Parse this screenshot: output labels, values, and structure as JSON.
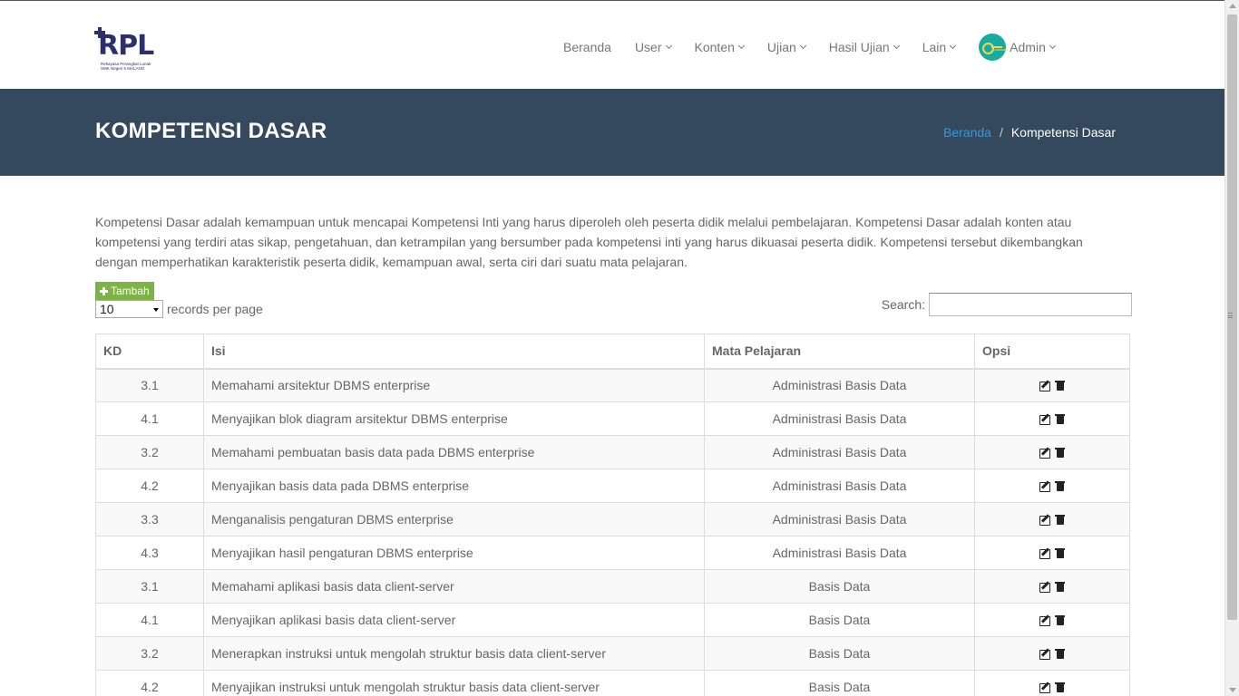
{
  "brand": {
    "logo_text": "RPL",
    "logo_subtitle_1": "Rekayasa Perangkat Lunak",
    "logo_subtitle_2": "SMK Negeri 5 MALANG"
  },
  "nav": {
    "items": [
      {
        "label": "Beranda",
        "dropdown": false
      },
      {
        "label": "User",
        "dropdown": true
      },
      {
        "label": "Konten",
        "dropdown": true
      },
      {
        "label": "Ujian",
        "dropdown": true
      },
      {
        "label": "Hasil Ujian",
        "dropdown": true
      },
      {
        "label": "Lain",
        "dropdown": true
      }
    ],
    "user_label": "Admin"
  },
  "header": {
    "title": "KOMPETENSI DASAR",
    "breadcrumb_home": "Beranda",
    "breadcrumb_separator": "/",
    "breadcrumb_current": "Kompetensi Dasar"
  },
  "description": "Kompetensi Dasar adalah kemampuan untuk mencapai Kompetensi Inti yang harus diperoleh oleh peserta didik melalui pembelajaran. Kompetensi Dasar adalah konten atau kompetensi yang terdiri atas sikap, pengetahuan, dan ketrampilan yang bersumber pada kompetensi inti yang harus dikuasai peserta didik. Kompetensi tersebut dikembangkan dengan memperhatikan karakteristik peserta didik, kemampuan awal, serta ciri dari suatu mata pelajaran.",
  "add_button_label": "Tambah",
  "per_page": {
    "value": "10",
    "label": "records per page"
  },
  "search": {
    "label": "Search:",
    "value": ""
  },
  "table": {
    "headers": {
      "kd": "KD",
      "isi": "Isi",
      "mata_pelajaran": "Mata Pelajaran",
      "opsi": "Opsi"
    },
    "rows": [
      {
        "kd": "3.1",
        "isi": "Memahami arsitektur DBMS enterprise",
        "mata_pelajaran": "Administrasi Basis Data"
      },
      {
        "kd": "4.1",
        "isi": "Menyajikan blok diagram arsitektur DBMS enterprise",
        "mata_pelajaran": "Administrasi Basis Data"
      },
      {
        "kd": "3.2",
        "isi": "Memahami pembuatan basis data pada DBMS enterprise",
        "mata_pelajaran": "Administrasi Basis Data"
      },
      {
        "kd": "4.2",
        "isi": "Menyajikan basis data pada DBMS enterprise",
        "mata_pelajaran": "Administrasi Basis Data"
      },
      {
        "kd": "3.3",
        "isi": "Menganalisis pengaturan DBMS enterprise",
        "mata_pelajaran": "Administrasi Basis Data"
      },
      {
        "kd": "4.3",
        "isi": "Menyajikan hasil pengaturan DBMS enterprise",
        "mata_pelajaran": "Administrasi Basis Data"
      },
      {
        "kd": "3.1",
        "isi": "Memahami aplikasi basis data client-server",
        "mata_pelajaran": "Basis Data"
      },
      {
        "kd": "4.1",
        "isi": "Menyajikan aplikasi basis data client-server",
        "mata_pelajaran": "Basis Data"
      },
      {
        "kd": "3.2",
        "isi": "Menerapkan instruksi untuk mengolah struktur basis data client-server",
        "mata_pelajaran": "Basis Data"
      },
      {
        "kd": "4.2",
        "isi": "Menyajikan instruksi untuk mengolah struktur basis data client-server",
        "mata_pelajaran": "Basis Data"
      }
    ]
  },
  "colors": {
    "header_bg": "#34495e",
    "link": "#3498db",
    "add_button": "#7cb342",
    "avatar_bg": "#1aaba0"
  }
}
